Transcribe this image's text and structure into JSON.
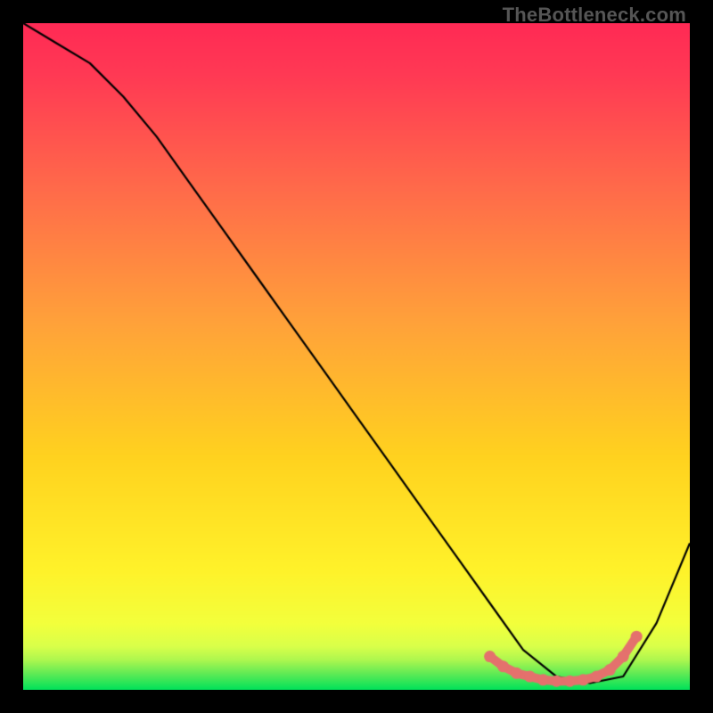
{
  "watermark": "TheBottleneck.com",
  "chart_data": {
    "type": "line",
    "title": "",
    "xlabel": "",
    "ylabel": "",
    "xlim": [
      0,
      100
    ],
    "ylim": [
      0,
      100
    ],
    "grid": false,
    "legend": false,
    "background_gradient_top": "#ff2a55",
    "background_gradient_mid": "#ffd400",
    "background_gradient_bottom": "#00e25a",
    "series": [
      {
        "name": "curve",
        "color": "#000000",
        "x": [
          0,
          5,
          10,
          15,
          20,
          25,
          30,
          35,
          40,
          45,
          50,
          55,
          60,
          65,
          70,
          75,
          80,
          85,
          90,
          95,
          100
        ],
        "values": [
          100,
          97,
          94,
          89,
          83,
          76,
          69,
          62,
          55,
          48,
          41,
          34,
          27,
          20,
          13,
          6,
          2,
          1,
          2,
          10,
          22
        ]
      }
    ],
    "highlight": {
      "name": "valley-dots",
      "color": "#e4716d",
      "x": [
        70,
        72,
        74,
        76,
        78,
        80,
        82,
        84,
        86,
        88,
        90,
        92
      ],
      "values": [
        5,
        3.5,
        2.5,
        2,
        1.5,
        1.3,
        1.3,
        1.5,
        2,
        3,
        5,
        8
      ]
    }
  }
}
